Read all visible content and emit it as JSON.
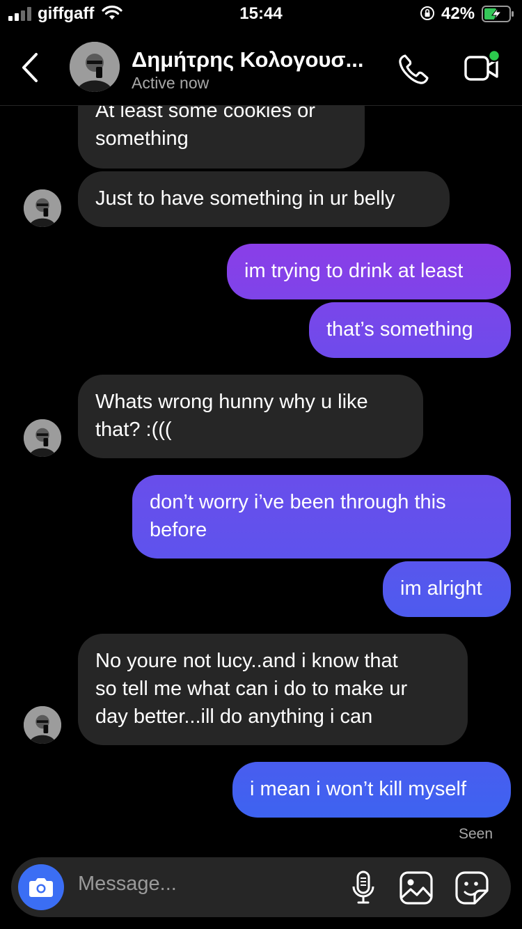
{
  "status_bar": {
    "carrier": "giffgaff",
    "time": "15:44",
    "battery": "42%"
  },
  "header": {
    "contact_name": "Δημήτρης Κολογουσ...",
    "status": "Active now"
  },
  "messages": [
    {
      "sender": "them",
      "text": "At least some cookies or\nsomething"
    },
    {
      "sender": "them",
      "text": "Just to have something in ur belly"
    },
    {
      "sender": "me",
      "text": "im trying to drink at least"
    },
    {
      "sender": "me",
      "text": "that’s something"
    },
    {
      "sender": "them",
      "text": "Whats wrong hunny why u like\nthat? :((("
    },
    {
      "sender": "me",
      "text": "don’t worry i’ve been through this\nbefore"
    },
    {
      "sender": "me",
      "text": "im alright"
    },
    {
      "sender": "them",
      "text": "No youre not lucy..and i know that\nso tell me what can i do to make ur\nday better...ill do anything i can"
    },
    {
      "sender": "me",
      "text": "i mean i won’t kill myself"
    }
  ],
  "seen_label": "Seen",
  "composer": {
    "placeholder": "Message..."
  },
  "colors": {
    "incoming_bubble": "#262626",
    "outgoing_gradient": [
      "#8a3ee8",
      "#3d63f0"
    ],
    "background": "#000000",
    "camera_button": "#3b6ef4",
    "video_dot": "#2cc84d"
  },
  "icons": [
    "signal-icon",
    "wifi-icon",
    "rotation-lock-icon",
    "battery-charging-icon",
    "back-chevron-icon",
    "phone-icon",
    "video-camera-icon",
    "camera-icon",
    "microphone-icon",
    "gallery-icon",
    "sticker-icon"
  ]
}
